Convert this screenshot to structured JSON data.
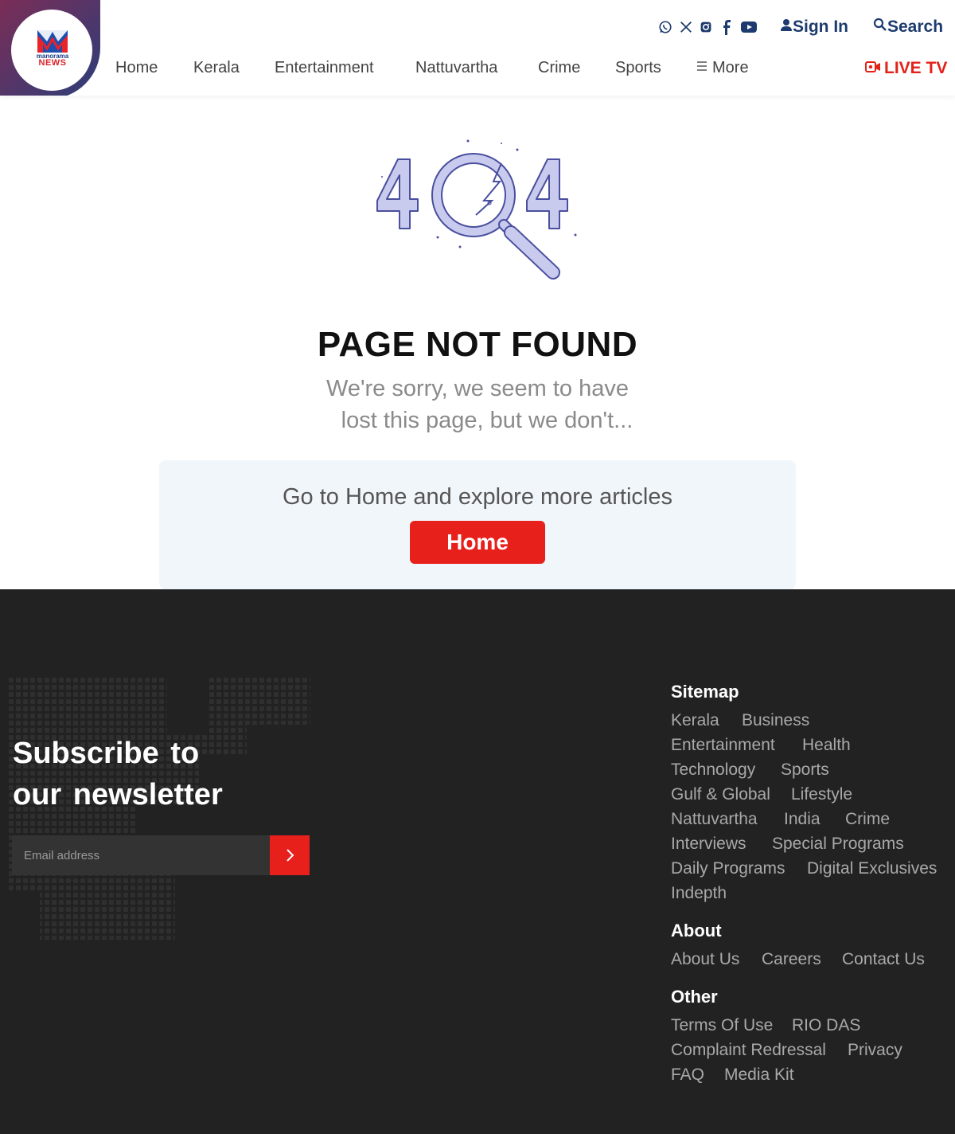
{
  "header": {
    "logo": {
      "line1": "manorama",
      "line2": "NEWS"
    },
    "social_icons": [
      "whatsapp-icon",
      "x-icon",
      "instagram-icon",
      "facebook-icon",
      "youtube-icon"
    ],
    "sign_in": "Sign In",
    "search": "Search",
    "live_tv": "LIVE TV",
    "nav": [
      "Home",
      "Kerala",
      "Entertainment",
      "Nattuvartha",
      "Crime",
      "Sports",
      "More"
    ],
    "colors": {
      "brand_dark": "#1d3b6e",
      "accent_red": "#e32219"
    }
  },
  "error": {
    "code": "404",
    "title": "PAGE NOT FOUND",
    "subtitle_line1": "We're sorry, we seem to have",
    "subtitle_line2": "lost this page, but we don't...",
    "cta_text": "Go to Home and explore more articles",
    "home_button": "Home"
  },
  "footer": {
    "newsletter_line1": "Subscribe to",
    "newsletter_line2": "our newsletter",
    "email_placeholder": "Email address",
    "sitemap_title": "Sitemap",
    "sitemap": [
      "Kerala",
      "Business",
      "Entertainment",
      "Health",
      "Technology",
      "Sports",
      "Gulf & Global",
      "Lifestyle",
      "Nattuvartha",
      "India",
      "Crime",
      "Interviews",
      "Special Programs",
      "Daily Programs",
      "Digital Exclusives",
      "Indepth"
    ],
    "about_title": "About",
    "about": [
      "About Us",
      "Careers",
      "Contact Us"
    ],
    "other_title": "Other",
    "other": [
      "Terms Of Use",
      "RIO DAS",
      "Complaint Redressal",
      "Privacy",
      "FAQ",
      "Media Kit"
    ]
  }
}
